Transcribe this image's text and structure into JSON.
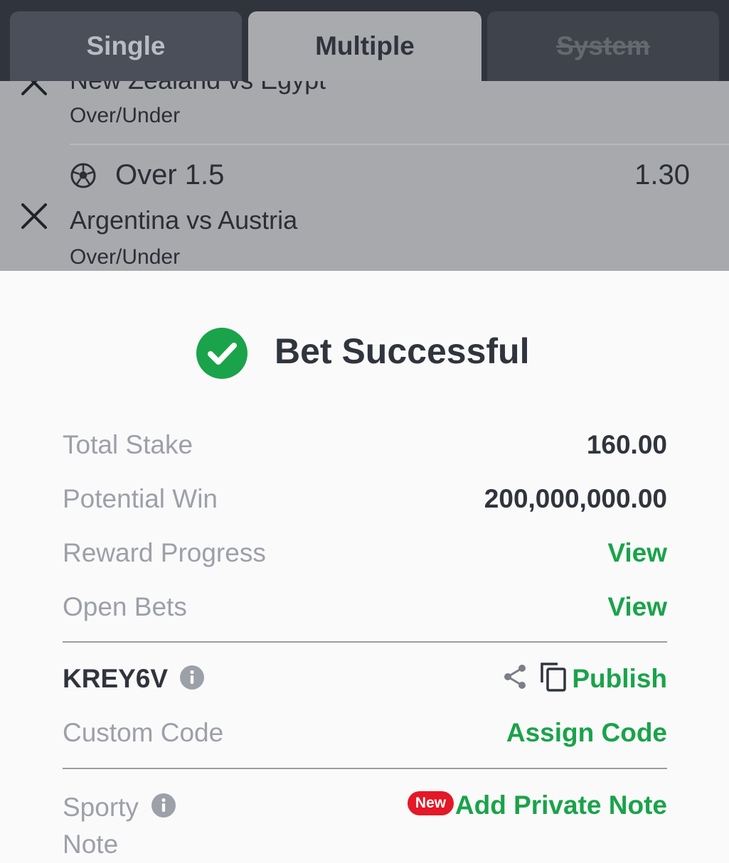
{
  "tabs": {
    "single": "Single",
    "multiple": "Multiple",
    "system": "System"
  },
  "betslip": {
    "selections": [
      {
        "match": "New Zealand vs Egypt",
        "market": "Over/Under"
      },
      {
        "pick": "Over 1.5",
        "odds": "1.30",
        "match": "Argentina vs Austria",
        "market": "Over/Under"
      }
    ]
  },
  "result": {
    "title": "Bet Successful",
    "total_stake_label": "Total Stake",
    "total_stake_value": "160.00",
    "potential_win_label": "Potential Win",
    "potential_win_value": "200,000,000.00",
    "reward_progress_label": "Reward Progress",
    "reward_progress_link": "View",
    "open_bets_label": "Open Bets",
    "open_bets_link": "View",
    "booking_code": "KREY6V",
    "publish_label": "Publish",
    "custom_code_label": "Custom Code",
    "assign_code_label": "Assign Code",
    "sporty_note_label": "Sporty Note",
    "new_badge": "New",
    "add_note_label": "Add Private Note"
  },
  "colors": {
    "accent_green": "#1aa34a",
    "badge_red": "#e41827",
    "dark_text": "#30343d"
  },
  "icons": [
    "close-icon",
    "football-icon",
    "checkmark-circle-icon",
    "info-icon",
    "share-icon",
    "copy-icon"
  ]
}
